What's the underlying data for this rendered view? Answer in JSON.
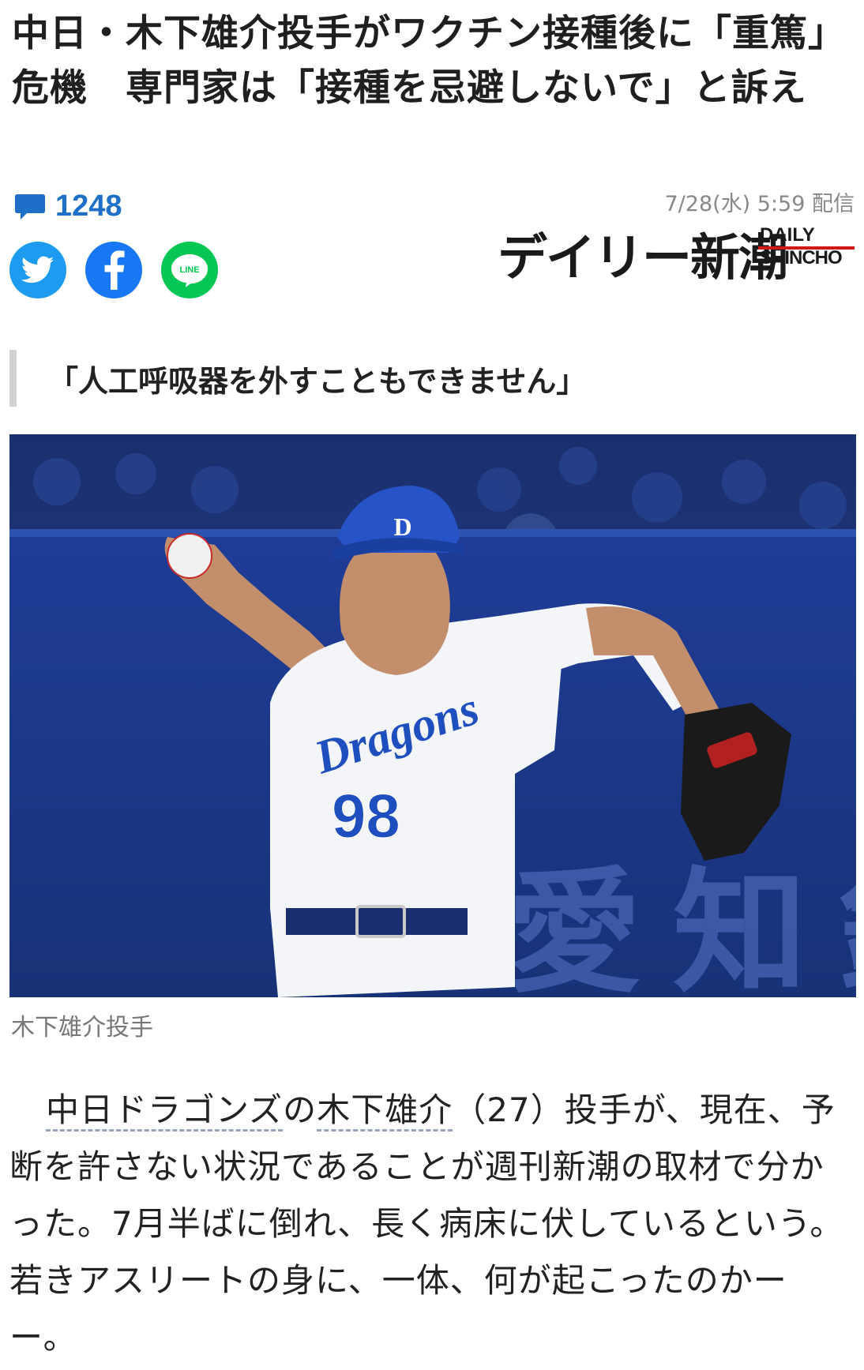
{
  "article": {
    "title": "中日・木下雄介投手がワクチン接種後に「重篤」危機　専門家は「接種を忌避しないで」と訴え",
    "comment_count": "1248",
    "date": "7/28(水) 5:59 配信",
    "publisher": {
      "name_ja": "デイリー新潮",
      "name_en_line1": "DAILY",
      "name_en_line2": "SHINCHO"
    },
    "share": {
      "twitter_icon": "twitter-icon",
      "facebook_icon": "facebook-icon",
      "line_label": "LINE"
    },
    "subheading": "「人工呼吸器を外すこともできません」",
    "photo": {
      "caption": "木下雄介投手",
      "jersey_text": "Dragons",
      "jersey_number": "98",
      "banner_text": "愛知銀"
    },
    "body": {
      "link_team": "中日ドラゴンズ",
      "no": "の",
      "link_player": "木下雄介",
      "rest": "（27）投手が、現在、予断を許さない状況であることが週刊新潮の取材で分かった。7月半ばに倒れ、長く病床に伏しているという。若きアスリートの身に、一体、何が起こったのかーー。"
    }
  },
  "colors": {
    "comment_blue": "#1e6fc8",
    "twitter": "#1d9bf0",
    "facebook": "#1877f2",
    "line": "#06c755",
    "logo_red": "#d01818"
  }
}
